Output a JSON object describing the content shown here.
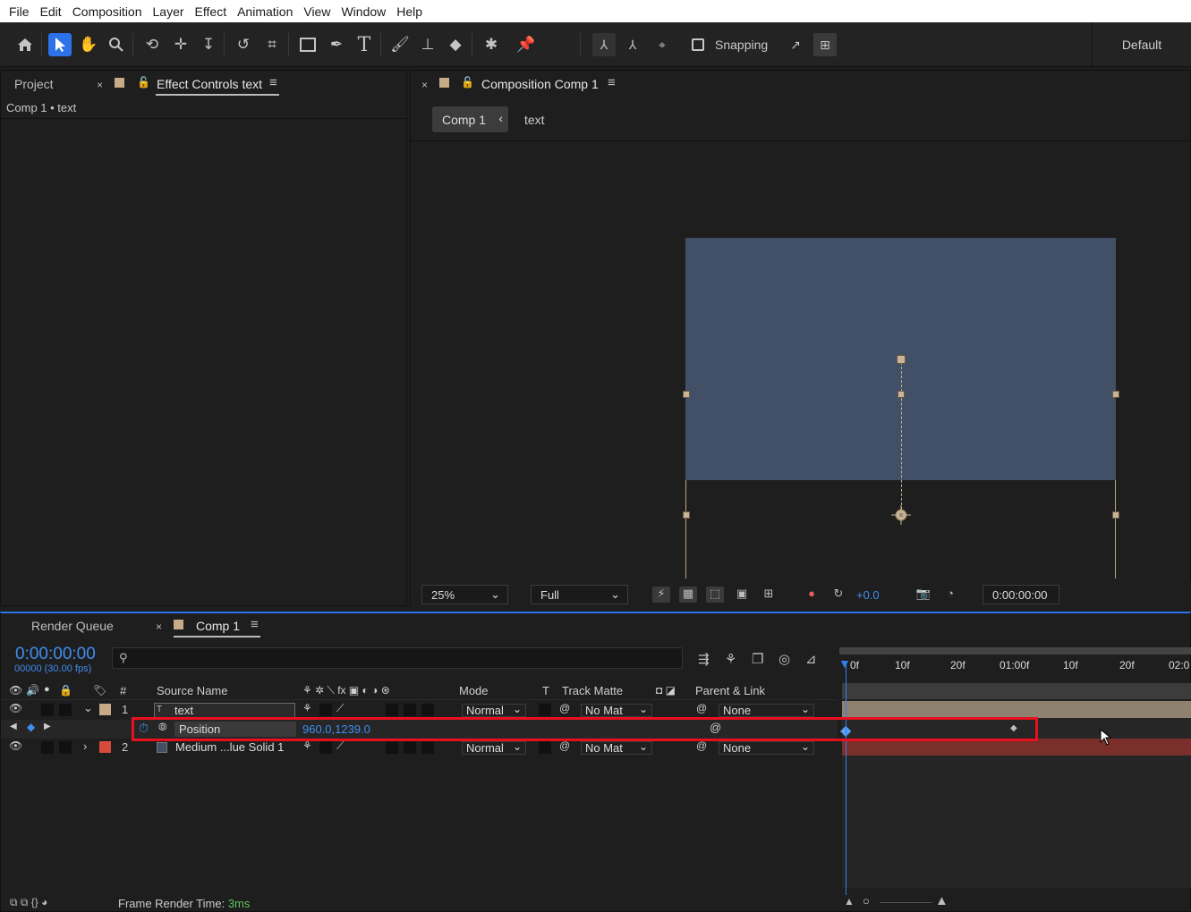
{
  "menu": [
    "File",
    "Edit",
    "Composition",
    "Layer",
    "Effect",
    "Animation",
    "View",
    "Window",
    "Help"
  ],
  "toolbar": {
    "tools": [
      "home-icon",
      "selection-tool-icon",
      "hand-tool-icon",
      "zoom-tool-icon",
      "orbit-camera-icon",
      "pan-camera-icon",
      "dolly-camera-icon",
      "rotation-tool-icon",
      "pan-behind-icon",
      "rectangle-tool-icon",
      "pen-tool-icon",
      "type-tool-icon",
      "brush-tool-icon",
      "clone-stamp-icon",
      "eraser-icon",
      "roto-brush-icon",
      "puppet-pin-icon"
    ],
    "snapping_label": "Snapping",
    "workspace": "Default"
  },
  "left_panel": {
    "tab_project": "Project",
    "tab_effect_controls": "Effect Controls text",
    "subtitle": "Comp 1 • text"
  },
  "viewer": {
    "tab_title": "Composition Comp 1",
    "breadcrumb_comp": "Comp 1",
    "breadcrumb_layer": "text",
    "zoom": "25%",
    "resolution": "Full",
    "exposure": "+0.0",
    "timecode": "0:00:00:00",
    "comp_color": "#415067"
  },
  "timeline": {
    "tab_render_queue": "Render Queue",
    "tab_comp": "Comp 1",
    "timecode": "0:00:00:00",
    "fps_info": "00000 (30.00 fps)",
    "columns": {
      "num": "#",
      "source_name": "Source Name",
      "mode": "Mode",
      "t": "T",
      "track_matte": "Track Matte",
      "parent_link": "Parent & Link"
    },
    "ruler_ticks": [
      "0f",
      "10f",
      "20f",
      "01:00f",
      "10f",
      "20f",
      "02:0"
    ],
    "layers": [
      {
        "num": "1",
        "name": "text",
        "mode": "Normal",
        "matte": "No Mat",
        "parent": "None",
        "label_color": "#c7aa86"
      },
      {
        "num": "2",
        "name": "Medium ...lue Solid 1",
        "mode": "Normal",
        "matte": "No Mat",
        "parent": "None",
        "label_color": "#d64c3c"
      }
    ],
    "property": {
      "name": "Position",
      "value": "960.0,1239.0"
    },
    "frame_render_label": "Frame Render Time:",
    "frame_render_value": "3ms"
  }
}
